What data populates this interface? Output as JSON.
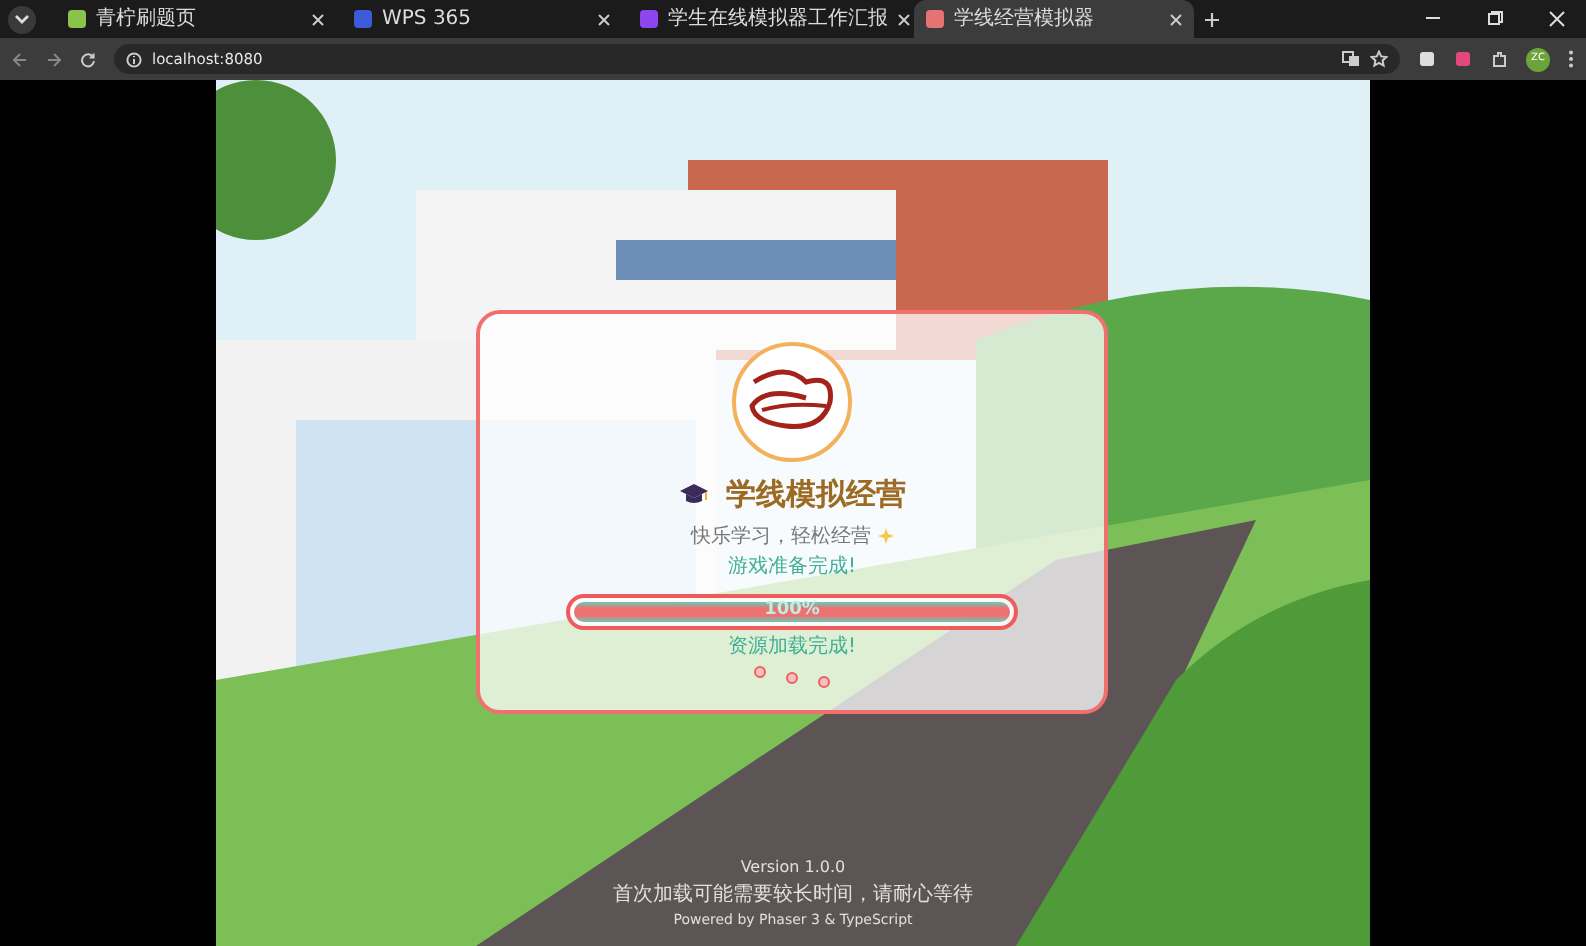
{
  "browser": {
    "tabs": [
      {
        "title": "青柠刷题页",
        "selected": false
      },
      {
        "title": "WPS 365",
        "selected": false
      },
      {
        "title": "学生在线模拟器工作汇报",
        "selected": false
      },
      {
        "title": "学线经营模拟器",
        "selected": true
      }
    ],
    "address": "localhost:8080",
    "profile": "ZC"
  },
  "loader": {
    "title": "学线模拟经营",
    "subtitle": "快乐学习，轻松经营",
    "status": "游戏准备完成!",
    "progress": {
      "level": 1,
      "reading": "100%"
    },
    "detail": "资源加载完成!"
  },
  "footer": {
    "version": "Version 1.0.0",
    "notice": "首次加载可能需要较长时间，请耐心等待",
    "credit": "Powered by Phaser 3 & TypeScript"
  }
}
